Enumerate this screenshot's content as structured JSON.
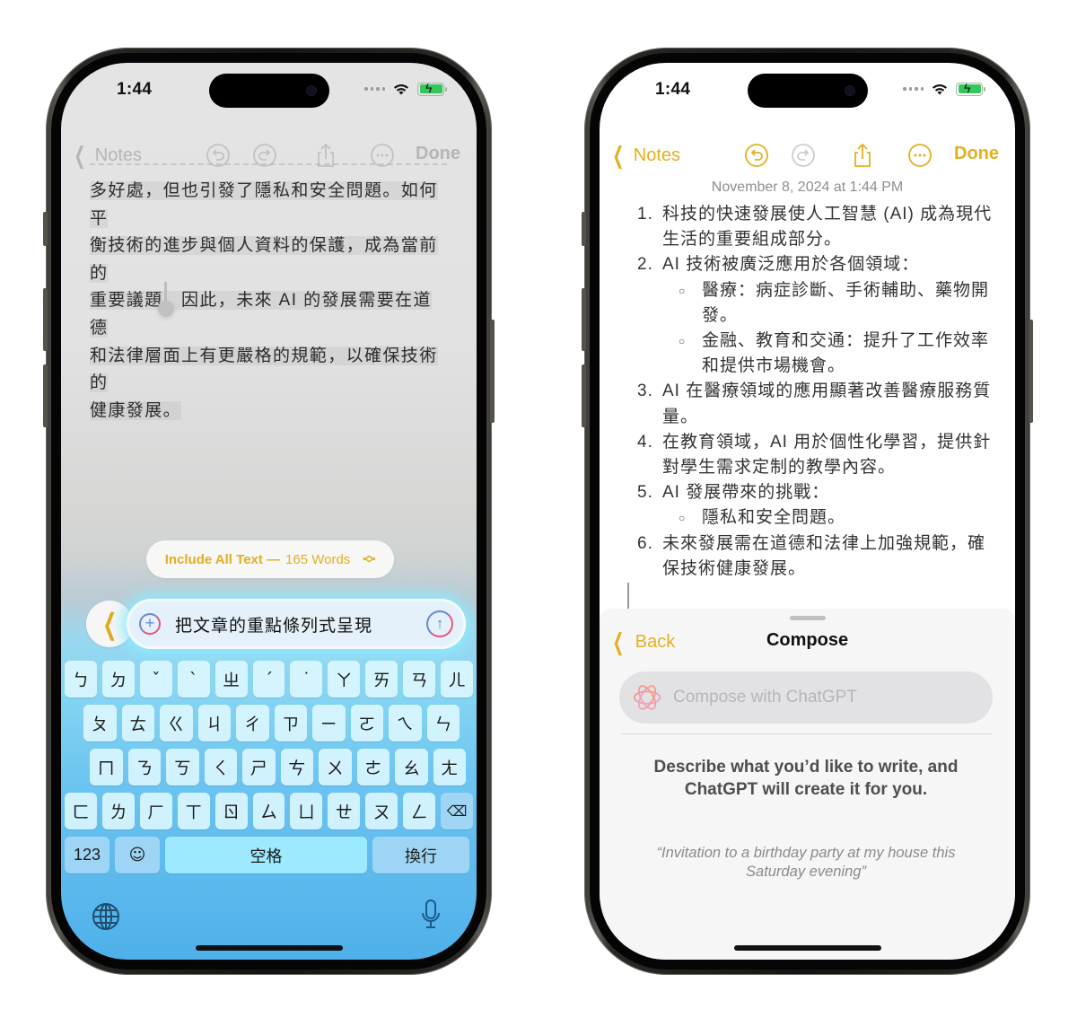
{
  "colors": {
    "accent": "#e3b021",
    "accent_dimmed": "#b5b5b5",
    "battery_green": "#34c759"
  },
  "left_phone": {
    "status_bar": {
      "time": "1:44",
      "icons": [
        "cellular-dots-icon",
        "wifi-icon",
        "battery-charging-icon"
      ]
    },
    "navbar": {
      "back_label": "Notes",
      "done_label": "Done",
      "icons": [
        "undo-icon",
        "redo-icon",
        "share-icon",
        "more-icon"
      ]
    },
    "note_text_lines": [
      "多好處，但也引發了隱私和安全問題。如何平",
      "衡技術的進步與個人資料的保護，成為當前的",
      "重要議題。因此，未來 AI 的發展需要在道德",
      "和法律層面上有更嚴格的規範，以確保技術的",
      "健康發展。"
    ],
    "include_pill": {
      "label_strong": "Include All Text —",
      "word_count": "165 Words",
      "icon": "chevron-up-down-icon"
    },
    "prompt": {
      "value": "把文章的重點條列式呈現",
      "add_icon": "plus-circle-icon",
      "send_icon": "arrow-up-circle-icon",
      "back_icon": "chevron-left-icon"
    },
    "keyboard": {
      "row1": [
        "ㄅ",
        "ㄉ",
        "ˇ",
        "ˋ",
        "ㄓ",
        "ˊ",
        "˙",
        "ㄚ",
        "ㄞ",
        "ㄢ",
        "ㄦ"
      ],
      "row2": [
        "ㄆ",
        "ㄊ",
        "ㄍ",
        "ㄐ",
        "ㄔ",
        "ㄗ",
        "ㄧ",
        "ㄛ",
        "ㄟ",
        "ㄣ"
      ],
      "row3": [
        "ㄇ",
        "ㄋ",
        "ㄎ",
        "ㄑ",
        "ㄕ",
        "ㄘ",
        "ㄨ",
        "ㄜ",
        "ㄠ",
        "ㄤ"
      ],
      "row4": [
        "ㄈ",
        "ㄌ",
        "ㄏ",
        "ㄒ",
        "ㄖ",
        "ㄙ",
        "ㄩ",
        "ㄝ",
        "ㄡ",
        "ㄥ"
      ],
      "delete_icon": "⌫",
      "numbers_label": "123",
      "emoji_icon": "☺",
      "space_label": "空格",
      "return_label": "換行",
      "globe_icon": "globe-icon",
      "mic_icon": "microphone-icon"
    }
  },
  "right_phone": {
    "status_bar": {
      "time": "1:44"
    },
    "navbar": {
      "back_label": "Notes",
      "done_label": "Done"
    },
    "date": "November 8, 2024 at 1:44 PM",
    "note_items": [
      {
        "type": "ol",
        "num": "1.",
        "text": "科技的快速發展使人工智慧 (AI) 成為現代生活的重要組成部分。"
      },
      {
        "type": "ol",
        "num": "2.",
        "text": "AI 技術被廣泛應用於各個領域："
      },
      {
        "type": "ul",
        "bullet": "○",
        "text": "醫療：病症診斷、手術輔助、藥物開發。"
      },
      {
        "type": "ul",
        "bullet": "○",
        "text": "金融、教育和交通：提升了工作效率和提供市場機會。"
      },
      {
        "type": "ol",
        "num": "3.",
        "text": "AI 在醫療領域的應用顯著改善醫療服務質量。"
      },
      {
        "type": "ol",
        "num": "4.",
        "text": "在教育領域，AI 用於個性化學習，提供針對學生需求定制的教學內容。"
      },
      {
        "type": "ol",
        "num": "5.",
        "text": "AI 發展帶來的挑戰："
      },
      {
        "type": "ul",
        "bullet": "○",
        "text": "隱私和安全問題。"
      },
      {
        "type": "ol",
        "num": "6.",
        "text": "未來發展需在道德和法律上加強規範，確保技術健康發展。"
      }
    ],
    "sheet": {
      "back_label": "Back",
      "title": "Compose",
      "input_placeholder": "Compose with ChatGPT",
      "input_value": "",
      "description": "Describe what you’d like to write, and ChatGPT will create it for you.",
      "example": "“Invitation to a birthday party at my house this Saturday evening”"
    }
  }
}
